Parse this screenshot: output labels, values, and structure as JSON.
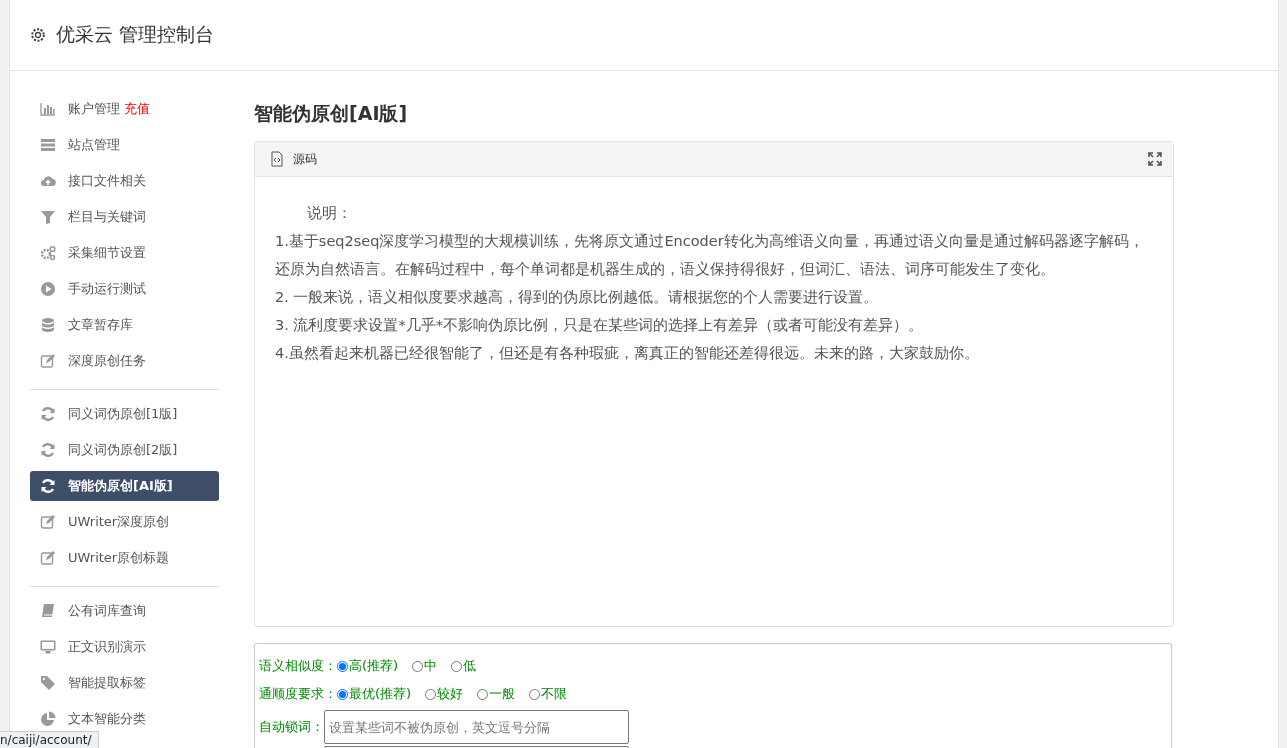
{
  "header": {
    "title": "优采云 管理控制台"
  },
  "sidebar": {
    "groups": [
      {
        "items": [
          {
            "label": "账户管理",
            "badge": "充值",
            "selected": false
          },
          {
            "label": "站点管理",
            "selected": false
          },
          {
            "label": "接口文件相关",
            "selected": false
          },
          {
            "label": "栏目与关键词",
            "selected": false
          },
          {
            "label": "采集细节设置",
            "selected": false
          },
          {
            "label": "手动运行测试",
            "selected": false
          },
          {
            "label": "文章暂存库",
            "selected": false
          },
          {
            "label": "深度原创任务",
            "selected": false
          }
        ]
      },
      {
        "items": [
          {
            "label": "同义词伪原创[1版]",
            "selected": false
          },
          {
            "label": "同义词伪原创[2版]",
            "selected": false
          },
          {
            "label": "智能伪原创[AI版]",
            "selected": true
          },
          {
            "label": "UWriter深度原创",
            "selected": false
          },
          {
            "label": "UWriter原创标题",
            "selected": false
          }
        ]
      },
      {
        "items": [
          {
            "label": "公有词库查询",
            "selected": false
          },
          {
            "label": "正文识别演示",
            "selected": false
          },
          {
            "label": "智能提取标签",
            "selected": false
          },
          {
            "label": "文本智能分类",
            "selected": false
          }
        ]
      }
    ]
  },
  "page_title": "智能伪原创[AI版]",
  "source_panel": {
    "title": "源码",
    "paragraphs": [
      "说明：",
      "1.基于seq2seq深度学习模型的大规模训练，先将原文通过Encoder转化为高维语义向量，再通过语义向量是通过解码器逐字解码，还原为自然语言。在解码过程中，每个单词都是机器生成的，语义保持得很好，但词汇、语法、词序可能发生了变化。",
      "2. 一般来说，语义相似度要求越高，得到的伪原比例越低。请根据您的个人需要进行设置。",
      "3. 流利度要求设置*几乎*不影响伪原比例，只是在某些词的选择上有差异（或者可能没有差异）。",
      "4.虽然看起来机器已经很智能了，但还是有各种瑕疵，离真正的智能还差得很远。未来的路，大家鼓励你。"
    ]
  },
  "options": {
    "radio_groups": [
      {
        "label": "语义相似度：",
        "choices": [
          {
            "label": "高(推荐)",
            "selected": true
          },
          {
            "label": "中",
            "selected": false
          },
          {
            "label": "低",
            "selected": false
          }
        ]
      },
      {
        "label": "通顺度要求：",
        "choices": [
          {
            "label": "最优(推荐)",
            "selected": true
          },
          {
            "label": "较好",
            "selected": false
          },
          {
            "label": "一般",
            "selected": false
          },
          {
            "label": "不限",
            "selected": false
          }
        ]
      }
    ],
    "lock_words": {
      "label": "自动锁词：",
      "placeholder": "设置某些词不被伪原创，英文逗号分隔"
    }
  },
  "status_url": "n/caiji/account/"
}
